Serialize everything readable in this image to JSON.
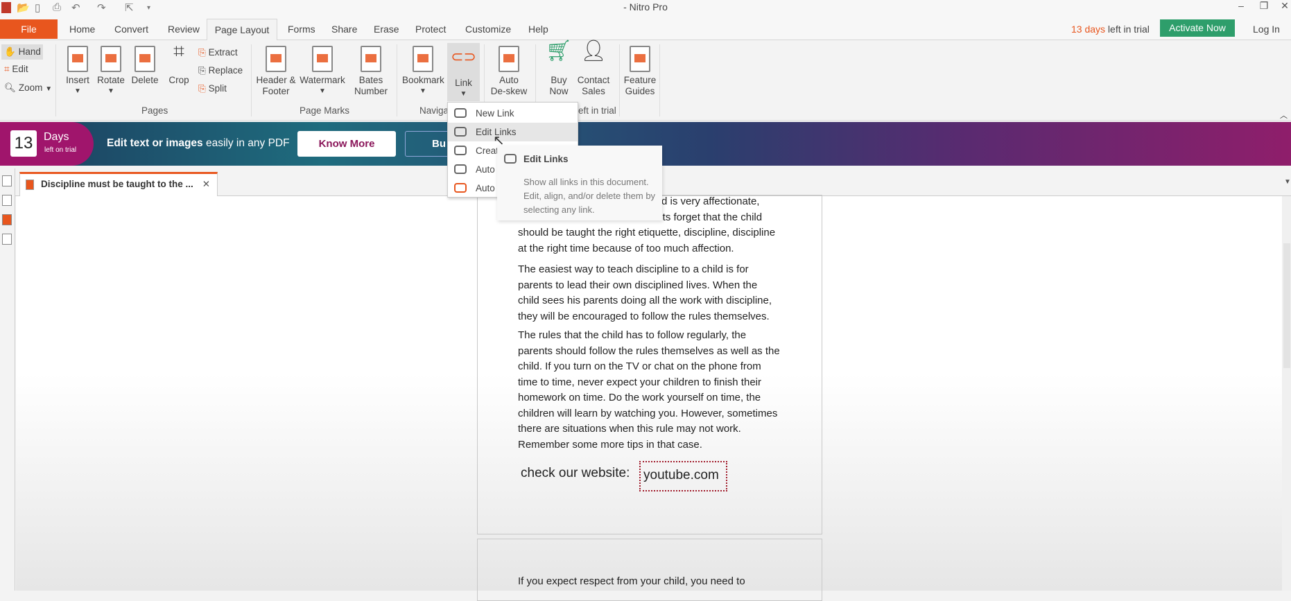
{
  "window": {
    "title": "- Nitro Pro",
    "minimize": "–",
    "restore": "❐",
    "close": "✕"
  },
  "quick_access": [
    "open-folder-icon",
    "save-icon",
    "print-icon",
    "undo-icon",
    "redo-icon",
    "select-icon",
    "customize-icon"
  ],
  "menu_tabs": [
    "File",
    "Home",
    "Convert",
    "Review",
    "Page Layout",
    "Forms",
    "Share",
    "Erase",
    "Protect",
    "Customize",
    "Help"
  ],
  "active_tab": "Page Layout",
  "trial": {
    "days": "13 days",
    "suffix": " left in trial",
    "activate": "Activate Now",
    "login": "Log In"
  },
  "ribbon": {
    "tools": [
      "Hand",
      "Edit",
      "Zoom"
    ],
    "pages": {
      "buttons": [
        "Insert",
        "Rotate",
        "Delete",
        "Crop"
      ],
      "small": [
        "Extract",
        "Replace",
        "Split"
      ],
      "label": "Pages"
    },
    "page_marks": {
      "buttons": [
        "Header &\nFooter",
        "Watermark",
        "Bates\nNumber"
      ],
      "label": "Page Marks"
    },
    "navigation": {
      "buttons": [
        "Bookmark",
        "Link"
      ],
      "label": "Naviga"
    },
    "deskew": "Auto\nDe-skew",
    "buy": "Buy\nNow",
    "contact": "Contact\nSales",
    "trial_label": "eft in trial",
    "guides": "Feature\nGuides"
  },
  "banner": {
    "days": "13",
    "days_label": "Days",
    "days_sub": "left on trial",
    "bold": "Edit text or images",
    "text": " easily in any PDF",
    "know_more": "Know More",
    "buy": "Bu"
  },
  "document_tab": {
    "title": "Discipline must be taught to the ...",
    "close": "✕"
  },
  "link_menu": {
    "items": [
      "New Link",
      "Edit Links",
      "Creat",
      "Auto",
      "Auto"
    ],
    "hovered": "Edit Links"
  },
  "tooltip": {
    "title": "Edit Links",
    "body": "Show all links in this document. Edit, align, and/or delete them by selecting any link."
  },
  "page": {
    "p1": [
      "hild is very affectionate,",
      "ents forget that the child",
      "should be taught the right etiquette, discipline, discipline",
      "at the right time because of too much affection."
    ],
    "p2": [
      "The easiest way to teach discipline to a child is for",
      "parents to lead their own disciplined lives. When the",
      "child sees his parents doing all the work with discipline,",
      "they will be encouraged to follow the rules themselves."
    ],
    "p3": [
      "The rules that the child has to follow regularly, the",
      "parents should follow the rules themselves as well as the",
      "child. If you turn on the TV or chat on the phone from",
      "time to time, never expect your children to finish their",
      "homework on time. Do the work yourself on time, the",
      "children will learn by watching you. However, sometimes",
      "there are situations when this rule may not work.",
      "Remember some more tips in that case."
    ],
    "website_label": "check our website:",
    "link": "youtube.com",
    "next_page_text": "If you expect respect from your child, you need to"
  },
  "colors": {
    "accent": "#e8561e",
    "activate": "#2e9e6b",
    "banner_magenta": "#a0156c",
    "link_border": "#a01a2a"
  }
}
